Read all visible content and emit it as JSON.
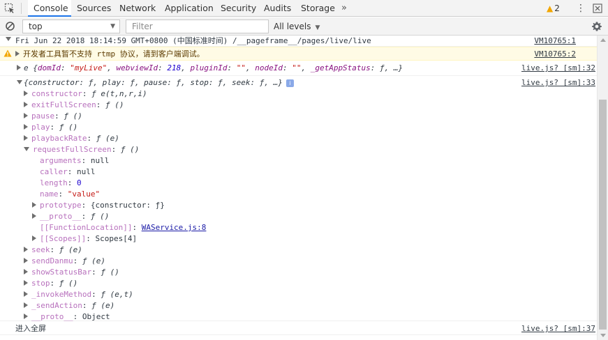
{
  "tabs": {
    "console": "Console",
    "sources": "Sources",
    "network": "Network",
    "application": "Application",
    "security": "Security",
    "audits": "Audits",
    "storage": "Storage",
    "more": "»",
    "warning_count": "2"
  },
  "toolbar": {
    "context": "top",
    "filter_placeholder": "Filter",
    "levels": "All levels"
  },
  "messages": {
    "timestamp": {
      "text": "Fri Jun 22 2018 18:14:59 GMT+0800 (中国标准时间) /__pageframe__/pages/live/live",
      "src": "VM10765:1"
    },
    "warning": {
      "text": "开发者工具暂不支持 rtmp 协议，请到客户端调试。",
      "src": "VM10765:2"
    },
    "event": {
      "prefix": "e {",
      "k1": "domId",
      "v1": "\"myLive\"",
      "k2": "webviewId",
      "v2": "218",
      "k3": "pluginId",
      "v3": "\"\"",
      "k4": "nodeId",
      "v4": "\"\"",
      "k5": "_getAppStatus",
      "v5": "ƒ",
      "suffix": ", …}",
      "src": "live.js? [sm]:32"
    },
    "object": {
      "summary": "{constructor: ƒ, play: ƒ, pause: ƒ, stop: ƒ, seek: ƒ, …}",
      "info": "i",
      "src": "live.js? [sm]:33",
      "props": [
        {
          "key": "constructor",
          "val": "ƒ e(t,n,r,i)"
        },
        {
          "key": "exitFullScreen",
          "val": "ƒ ()"
        },
        {
          "key": "pause",
          "val": "ƒ ()"
        },
        {
          "key": "play",
          "val": "ƒ ()"
        },
        {
          "key": "playbackRate",
          "val": "ƒ (e)"
        },
        {
          "key": "requestFullScreen",
          "val": "ƒ ()"
        }
      ],
      "fs_children": {
        "arguments_key": "arguments",
        "arguments_val": "null",
        "caller_key": "caller",
        "caller_val": "null",
        "length_key": "length",
        "length_val": "0",
        "name_key": "name",
        "name_val": "\"value\"",
        "prototype_key": "prototype",
        "prototype_val": "{constructor: ƒ}",
        "proto_key": "__proto__",
        "proto_val": "ƒ ()",
        "fnloc_key": "[[FunctionLocation]]",
        "fnloc_val": "WAService.js:8",
        "scopes_key": "[[Scopes]]",
        "scopes_val": "Scopes[4]"
      },
      "props2": [
        {
          "key": "seek",
          "val": "ƒ (e)"
        },
        {
          "key": "sendDanmu",
          "val": "ƒ (e)"
        },
        {
          "key": "showStatusBar",
          "val": "ƒ ()"
        },
        {
          "key": "stop",
          "val": "ƒ ()"
        },
        {
          "key": "_invokeMethod",
          "val": "ƒ (e,t)"
        },
        {
          "key": "_sendAction",
          "val": "ƒ (e)"
        },
        {
          "key": "__proto__",
          "val": "Object"
        }
      ]
    },
    "fullscreen": {
      "text": "进入全屏",
      "src": "live.js? [sm]:37"
    }
  },
  "colors": {
    "accent": "#1a73e8",
    "warning_bg": "#fffbe5",
    "property": "#881280",
    "string": "#c41a16",
    "number": "#1c00cf"
  }
}
